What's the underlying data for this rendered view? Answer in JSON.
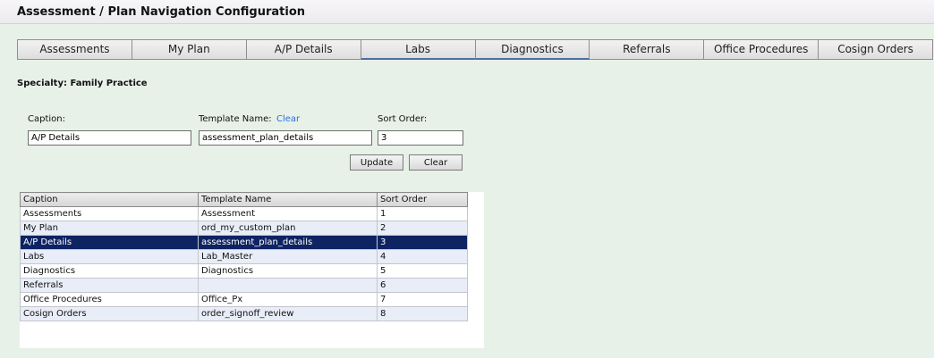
{
  "header": {
    "title": "Assessment / Plan Navigation Configuration"
  },
  "tabs": [
    {
      "label": "Assessments"
    },
    {
      "label": "My Plan"
    },
    {
      "label": "A/P Details"
    },
    {
      "label": "Labs"
    },
    {
      "label": "Diagnostics"
    },
    {
      "label": "Referrals"
    },
    {
      "label": "Office Procedures"
    },
    {
      "label": "Cosign Orders"
    }
  ],
  "specialty": "Specialty: Family Practice",
  "form": {
    "caption_label": "Caption:",
    "caption_value": "A/P Details",
    "template_label": "Template Name:",
    "template_clear": "Clear",
    "template_value": "assessment_plan_details",
    "sort_label": "Sort Order:",
    "sort_value": "3",
    "update_button": "Update",
    "clear_button": "Clear"
  },
  "table": {
    "headers": [
      "Caption",
      "Template Name",
      "Sort Order"
    ],
    "rows": [
      {
        "caption": "Assessments",
        "template": "Assessment",
        "sort": "1"
      },
      {
        "caption": "My Plan",
        "template": "ord_my_custom_plan",
        "sort": "2"
      },
      {
        "caption": "A/P Details",
        "template": "assessment_plan_details",
        "sort": "3"
      },
      {
        "caption": "Labs",
        "template": "Lab_Master",
        "sort": "4"
      },
      {
        "caption": "Diagnostics",
        "template": "Diagnostics",
        "sort": "5"
      },
      {
        "caption": "Referrals",
        "template": "",
        "sort": "6"
      },
      {
        "caption": "Office Procedures",
        "template": "Office_Px",
        "sort": "7"
      },
      {
        "caption": "Cosign Orders",
        "template": "order_signoff_review",
        "sort": "8"
      }
    ]
  }
}
